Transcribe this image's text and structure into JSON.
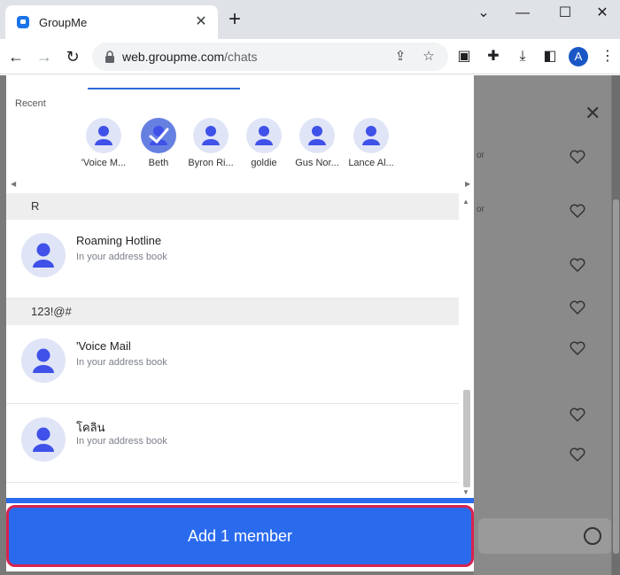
{
  "browser": {
    "tab_title": "GroupMe",
    "url_host": "web.groupme.com",
    "url_path": "/chats",
    "profile_initial": "A",
    "icons": [
      "groupme-favicon",
      "close-icon",
      "plus-icon",
      "minimize-icon",
      "maximize-icon",
      "window-close-icon",
      "back-icon",
      "forward-icon",
      "reload-icon",
      "lock-icon",
      "share-icon",
      "star-icon",
      "screen-capture-icon",
      "extensions-icon",
      "download-icon",
      "side-panel-icon",
      "menu-icon"
    ]
  },
  "modal": {
    "recent_label": "Recent",
    "recent": [
      {
        "name": "'Voice M...",
        "selected": false
      },
      {
        "name": "Beth",
        "selected": true
      },
      {
        "name": "Byron Ri...",
        "selected": false
      },
      {
        "name": "goldie",
        "selected": false
      },
      {
        "name": "Gus Nor...",
        "selected": false
      },
      {
        "name": "Lance Al...",
        "selected": false
      }
    ],
    "sections": [
      {
        "header": "R",
        "contacts": [
          {
            "name": "Roaming Hotline",
            "sub": "In your address book"
          }
        ]
      },
      {
        "header": "123!@#",
        "contacts": [
          {
            "name": "'Voice Mail",
            "sub": "In your address book"
          },
          {
            "name": "โคลิน",
            "sub": "In your address book"
          }
        ]
      }
    ],
    "add_button_label": "Add 1 member"
  },
  "background": {
    "snippets": [
      "or",
      "or"
    ]
  },
  "colors": {
    "accent": "#2a6bee",
    "highlight_border": "#d6244f",
    "avatar_bg": "#dfe4f7",
    "avatar_fg": "#3f51e8"
  }
}
